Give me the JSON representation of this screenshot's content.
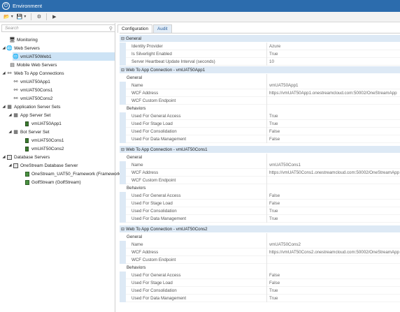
{
  "window": {
    "title": "Environment"
  },
  "toolbar": {
    "buttons": [
      {
        "icon": "open-folder-icon",
        "glyph": "📂"
      },
      {
        "icon": "save-icon",
        "glyph": "💾"
      },
      {
        "icon": "gear-icon",
        "glyph": "⚙"
      },
      {
        "icon": "play-icon",
        "glyph": "▶"
      }
    ]
  },
  "search": {
    "placeholder": "Search"
  },
  "tree": {
    "monitoring": "Monitoring",
    "web_servers": "Web Servers",
    "vmUAT50Web1": "vmUAT50Web1",
    "mobile_web_servers": "Mobile Web Servers",
    "web_to_app": "Web To App Connections",
    "app1": "vmUAT50App1",
    "cons1": "vmUAT50Cons1",
    "cons2": "vmUAT50Cons2",
    "app_server_sets": "Application Server Sets",
    "app_server_set": "App Server Set",
    "app_set_app1": "vmUAT50App1",
    "bot_server_set": "Bot Server Set",
    "bot_cons1": "vmUAT50Cons1",
    "bot_cons2": "vmUAT50Cons2",
    "database_servers": "Database Servers",
    "onestream_db_server": "OneStream Database Server",
    "db_framework": "OneStream_UAT50_Framework (Framework)",
    "db_golf": "GolfStream (GolfStream)"
  },
  "tabs": {
    "configuration": "Configuration",
    "audit": "Audit"
  },
  "grid": {
    "general": {
      "header": "General",
      "identity_provider": {
        "label": "Identity Provider",
        "value": "Azure"
      },
      "silverlight": {
        "label": "Is Silverlight Enabled",
        "value": "True"
      },
      "heartbeat": {
        "label": "Server Heartbeat Update Interval (seconds)",
        "value": "10"
      }
    },
    "conn1": {
      "header": "Web To App Connection - vmUAT50App1",
      "general": "General",
      "name": {
        "label": "Name",
        "value": "vmUAT50App1"
      },
      "wcf": {
        "label": "WCF Address",
        "value": "https://vmUAT50App1.onestreamcloud.com:50002/OneStreamApp"
      },
      "custom": {
        "label": "WCF Custom Endpoint",
        "value": ""
      },
      "behaviors": "Behaviors",
      "general_access": {
        "label": "Used For General Access",
        "value": "True"
      },
      "stage_load": {
        "label": "Used For Stage Load",
        "value": "True"
      },
      "consolidation": {
        "label": "Used For Consolidation",
        "value": "False"
      },
      "data_mgmt": {
        "label": "Used For Data Management",
        "value": "False"
      }
    },
    "conn2": {
      "header": "Web To App Connection - vmUAT50Cons1",
      "general": "General",
      "name": {
        "label": "Name",
        "value": "vmUAT50Cons1"
      },
      "wcf": {
        "label": "WCF Address",
        "value": "https://vmUAT50Cons1.onestreamcloud.com:50002/OneStreamApp"
      },
      "custom": {
        "label": "WCF Custom Endpoint",
        "value": ""
      },
      "behaviors": "Behaviors",
      "general_access": {
        "label": "Used For General Access",
        "value": "False"
      },
      "stage_load": {
        "label": "Used For Stage Load",
        "value": "False"
      },
      "consolidation": {
        "label": "Used For Consolidation",
        "value": "True"
      },
      "data_mgmt": {
        "label": "Used For Data Management",
        "value": "True"
      }
    },
    "conn3": {
      "header": "Web To App Connection - vmUAT50Cons2",
      "general": "General",
      "name": {
        "label": "Name",
        "value": "vmUAT50Cons2"
      },
      "wcf": {
        "label": "WCF Address",
        "value": "https://vmUAT50Cons2.onestreamcloud.com:50002/OneStreamApp"
      },
      "custom": {
        "label": "WCF Custom Endpoint",
        "value": ""
      },
      "behaviors": "Behaviors",
      "general_access": {
        "label": "Used For General Access",
        "value": "False"
      },
      "stage_load": {
        "label": "Used For Stage Load",
        "value": "False"
      },
      "consolidation": {
        "label": "Used For Consolidation",
        "value": "True"
      },
      "data_mgmt": {
        "label": "Used For Data Management",
        "value": "True"
      }
    }
  }
}
